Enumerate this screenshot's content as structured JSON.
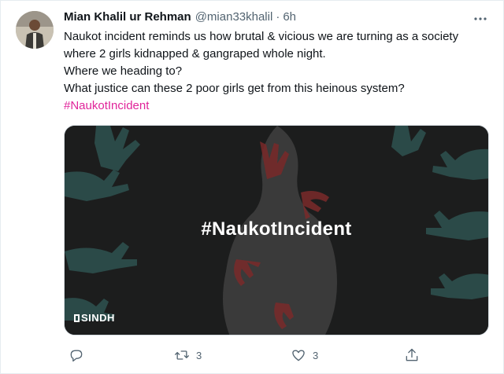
{
  "tweet": {
    "author": {
      "display_name": "Mian Khalil ur Rehman",
      "handle": "@mian33khalil",
      "separator": "·",
      "time": "6h",
      "avatar_icon": "profile-photo"
    },
    "text_lines": [
      "Naukot incident reminds us how brutal & vicious we are turning as a society",
      "where 2 girls kidnapped & gangraped whole night.",
      "Where we heading to?",
      "What justice can these 2 poor girls get from this heinous system?"
    ],
    "hashtag": "#NaukotIncident",
    "hashtag_color": "#e0249a",
    "media": {
      "title": "#NaukotIncident",
      "brand": "SINDH",
      "background_color": "#1c1d1d",
      "hand_color_dark": "#2b4a48",
      "hand_color_red": "#7a2a2a"
    },
    "actions": {
      "reply": {
        "icon": "reply-icon",
        "count": ""
      },
      "retweet": {
        "icon": "retweet-icon",
        "count": "3"
      },
      "like": {
        "icon": "heart-icon",
        "count": "3"
      },
      "share": {
        "icon": "share-icon",
        "count": ""
      }
    }
  }
}
